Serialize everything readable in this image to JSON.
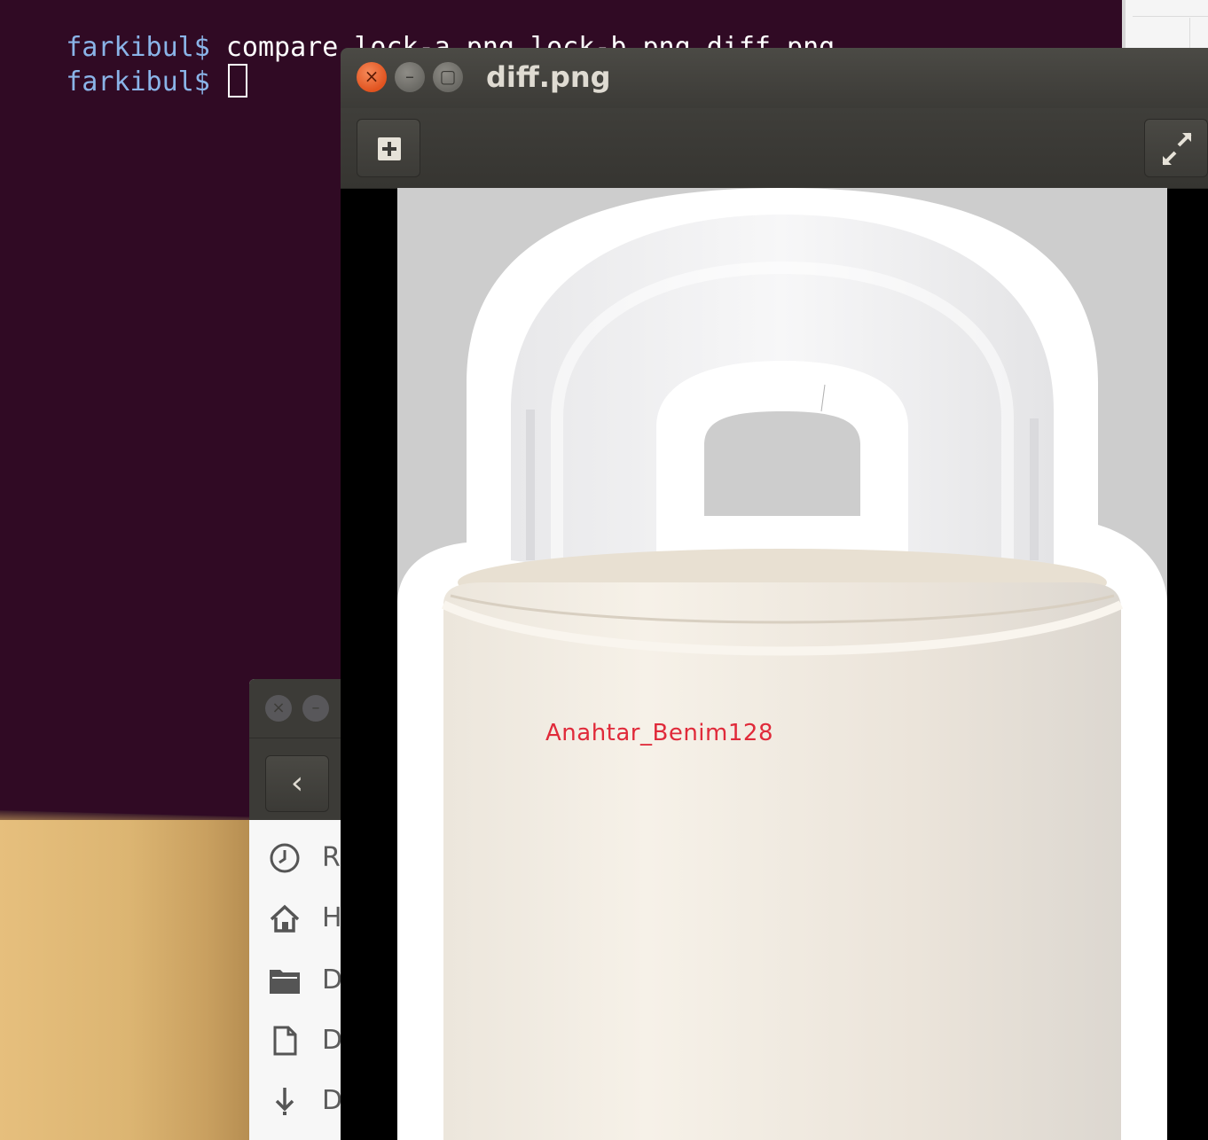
{
  "terminal": {
    "lines": [
      {
        "prompt": "farkibul$",
        "command": " compare lock-a.png lock-b.png diff.png"
      },
      {
        "prompt": "farkibul$",
        "command": " "
      }
    ]
  },
  "viewer": {
    "title": "diff.png",
    "buttons": {
      "close": "close-icon",
      "minimize": "minimize-icon",
      "maximize": "maximize-icon",
      "gallery": "add-icon",
      "fullscreen": "fullscreen-icon"
    },
    "image": {
      "text": "Anahtar_Benim128"
    }
  },
  "file_manager": {
    "sidebar": [
      {
        "icon": "clock-icon",
        "label": "R"
      },
      {
        "icon": "home-icon",
        "label": "H"
      },
      {
        "icon": "folder-icon",
        "label": "D"
      },
      {
        "icon": "document-icon",
        "label": "D"
      },
      {
        "icon": "download-icon",
        "label": "D"
      }
    ]
  },
  "colors": {
    "terminal_bg": "#300a24",
    "prompt": "#8ab4e8",
    "diff_text": "#e02a3a",
    "close_button": "#e1531f"
  }
}
